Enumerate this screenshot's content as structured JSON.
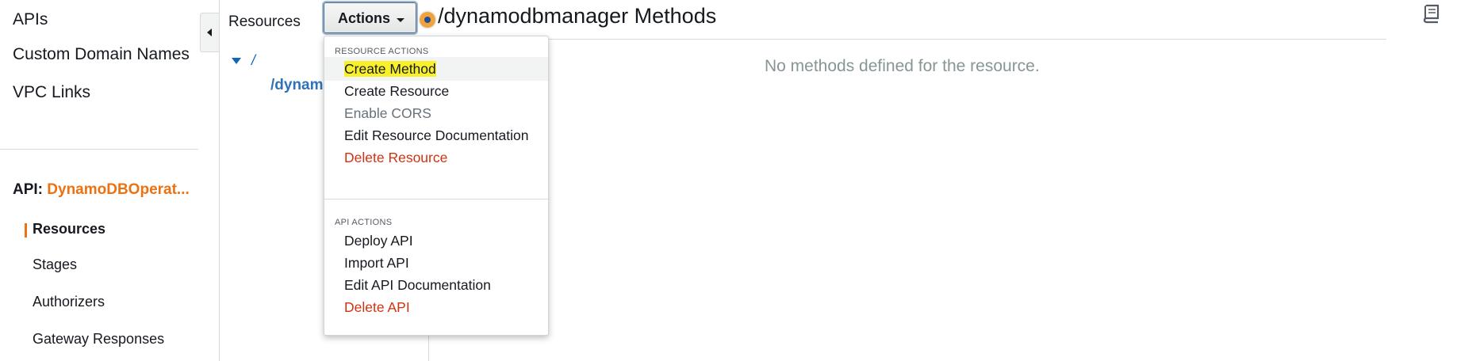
{
  "nav": {
    "links": [
      "APIs",
      "Custom Domain Names",
      "VPC Links"
    ],
    "api_prefix": "API:",
    "api_name": "DynamoDBOperat...",
    "sub_items": [
      "Resources",
      "Stages",
      "Authorizers",
      "Gateway Responses"
    ],
    "active_item": "Resources"
  },
  "resources_panel": {
    "label": "Resources",
    "actions_button": "Actions",
    "tree_root": "/",
    "tree_child": "/dynamodbmanager"
  },
  "main": {
    "title": "/dynamodbmanager Methods",
    "empty_message": "No methods defined for the resource."
  },
  "actions_menu": {
    "resource_header": "RESOURCE ACTIONS",
    "resource_items": [
      {
        "label": "Create Method",
        "state": "highlighted"
      },
      {
        "label": "Create Resource",
        "state": "normal"
      },
      {
        "label": "Enable CORS",
        "state": "disabled"
      },
      {
        "label": "Edit Resource Documentation",
        "state": "normal"
      },
      {
        "label": "Delete Resource",
        "state": "danger"
      }
    ],
    "api_header": "API ACTIONS",
    "api_items": [
      {
        "label": "Deploy API",
        "state": "normal"
      },
      {
        "label": "Import API",
        "state": "normal"
      },
      {
        "label": "Edit API Documentation",
        "state": "normal"
      },
      {
        "label": "Delete API",
        "state": "danger"
      }
    ]
  },
  "icons": [
    "collapse-left-icon",
    "tree-expand-icon",
    "dropdown-caret-icon",
    "notification-dot-icon",
    "book-icon"
  ],
  "colors": {
    "accent": "#ec7211",
    "link": "#1166bb",
    "danger": "#d13212",
    "highlight": "#f9f02c"
  }
}
